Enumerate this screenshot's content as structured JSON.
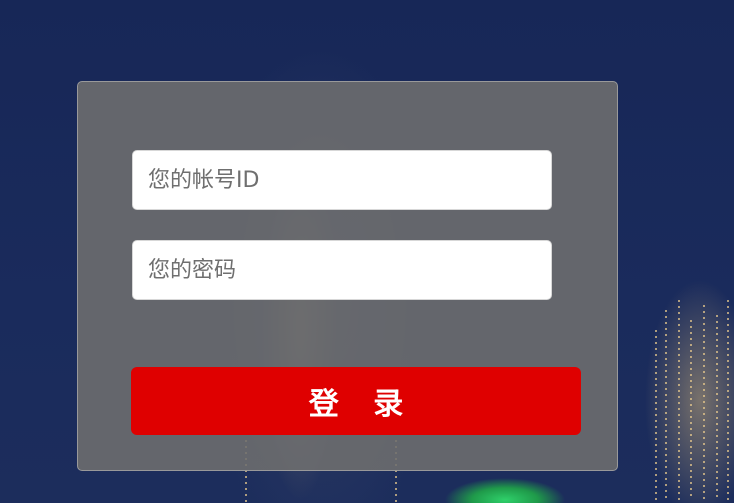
{
  "login_form": {
    "account_placeholder": "您的帐号ID",
    "password_placeholder": "您的密码",
    "submit_label": "登 录"
  },
  "colors": {
    "background": "#1a2b5c",
    "panel": "#6e6e6e",
    "button": "#df0000",
    "button_text": "#ffffff"
  }
}
